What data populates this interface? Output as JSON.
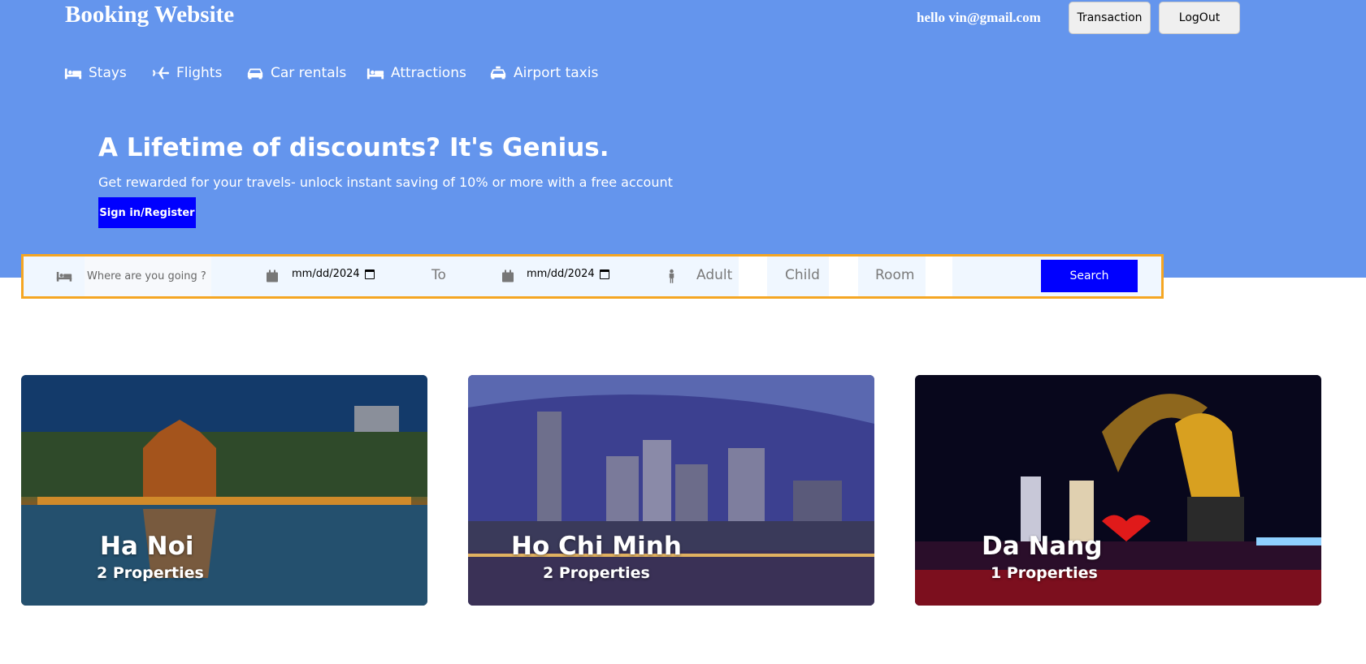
{
  "header": {
    "brand": "Booking Website",
    "greeting": "hello vin@gmail.com",
    "transaction_label": "Transaction",
    "logout_label": "LogOut"
  },
  "nav": {
    "items": [
      {
        "label": "Stays",
        "icon": "bed-icon"
      },
      {
        "label": "Flights",
        "icon": "plane-icon"
      },
      {
        "label": "Car rentals",
        "icon": "car-icon"
      },
      {
        "label": "Attractions",
        "icon": "bed-icon"
      },
      {
        "label": "Airport taxis",
        "icon": "taxi-icon"
      }
    ]
  },
  "hero": {
    "headline": "A Lifetime of discounts? It's Genius.",
    "subline": "Get rewarded for your travels- unlock instant saving of 10% or more with a free account",
    "signin_label": "Sign in/Register"
  },
  "search": {
    "destination_placeholder": "Where are you going ?",
    "start_date": "mm/dd/2024",
    "to_label": "To",
    "end_date": "mm/dd/2024",
    "adult_placeholder": "Adult",
    "child_placeholder": "Child",
    "room_placeholder": "Room",
    "search_label": "Search"
  },
  "cities": [
    {
      "name": "Ha Noi",
      "properties": "2 Properties"
    },
    {
      "name": "Ho Chi Minh",
      "properties": "2 Properties"
    },
    {
      "name": "Da Nang",
      "properties": "1 Properties"
    }
  ],
  "colors": {
    "hero_bg": "#6495ed",
    "primary_button": "#0000ff",
    "search_border": "#f5a623"
  }
}
